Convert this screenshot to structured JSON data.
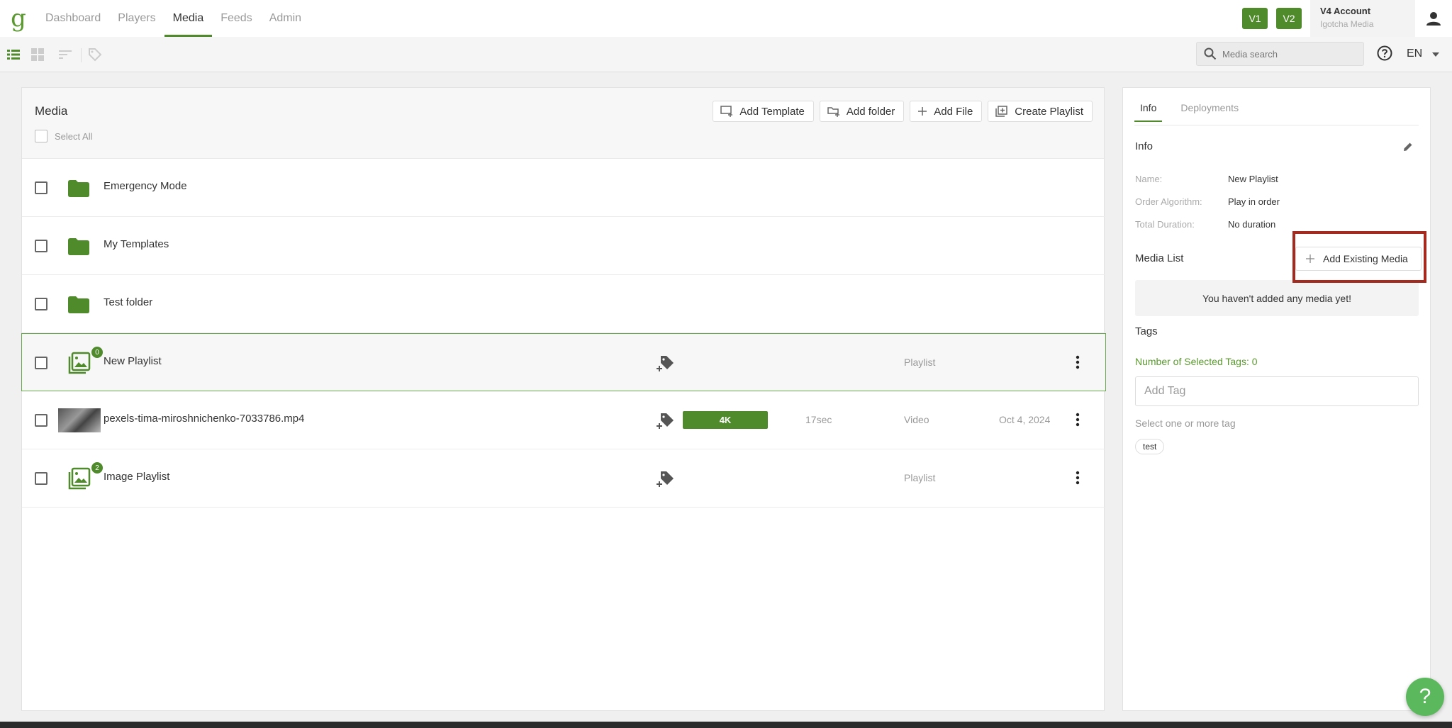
{
  "nav": {
    "logo": "g",
    "items": [
      "Dashboard",
      "Players",
      "Media",
      "Feeds",
      "Admin"
    ],
    "active": "Media",
    "v1": "V1",
    "v2": "V2",
    "account_name": "V4 Account",
    "account_org": "Igotcha Media"
  },
  "toolbar": {
    "search_placeholder": "Media search",
    "language": "EN"
  },
  "media": {
    "title": "Media",
    "select_all": "Select All",
    "buttons": {
      "add_template": "Add Template",
      "add_folder": "Add folder",
      "add_file": "Add File",
      "create_playlist": "Create Playlist"
    },
    "rows": [
      {
        "name": "Emergency Mode",
        "kind": "folder"
      },
      {
        "name": "My Templates",
        "kind": "folder"
      },
      {
        "name": "Test folder",
        "kind": "folder"
      },
      {
        "name": "New Playlist",
        "kind": "playlist",
        "badge": "0",
        "type": "Playlist"
      },
      {
        "name": "pexels-tima-miroshnichenko-7033786.mp4",
        "kind": "video",
        "resolution": "4K",
        "duration": "17sec",
        "type": "Video",
        "date": "Oct 4, 2024"
      },
      {
        "name": "Image Playlist",
        "kind": "playlist",
        "badge": "2",
        "type": "Playlist"
      }
    ]
  },
  "info": {
    "tabs": [
      "Info",
      "Deployments"
    ],
    "section_title": "Info",
    "name_label": "Name:",
    "name_value": "New Playlist",
    "order_label": "Order Algorithm:",
    "order_value": "Play in order",
    "duration_label": "Total Duration:",
    "duration_value": "No duration",
    "media_list_title": "Media List",
    "add_existing": "Add Existing Media",
    "empty_message": "You haven't added any media yet!",
    "tags_title": "Tags",
    "selected_tags": "Number of Selected Tags: 0",
    "add_tag_placeholder": "Add Tag",
    "select_hint": "Select one or more tag",
    "tag_chips": [
      "test"
    ]
  },
  "help_fab": "?",
  "colors": {
    "brand_green": "#4f8a2b",
    "highlight_red": "#a42a20"
  }
}
